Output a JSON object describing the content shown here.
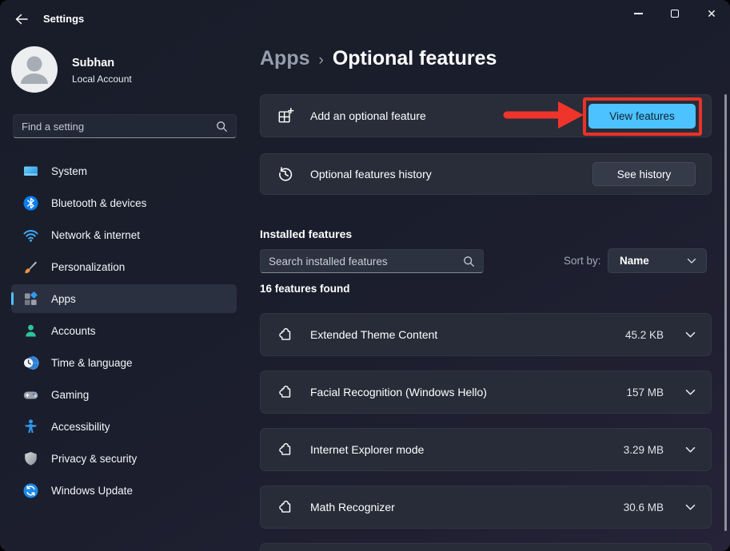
{
  "window": {
    "title": "Settings",
    "controls": {
      "minimize": "minimize",
      "maximize": "maximize",
      "close": "close"
    }
  },
  "user": {
    "name": "Subhan",
    "account_type": "Local Account"
  },
  "sidebar": {
    "search_placeholder": "Find a setting",
    "items": [
      {
        "label": "System",
        "selected": false
      },
      {
        "label": "Bluetooth & devices",
        "selected": false
      },
      {
        "label": "Network & internet",
        "selected": false
      },
      {
        "label": "Personalization",
        "selected": false
      },
      {
        "label": "Apps",
        "selected": true
      },
      {
        "label": "Accounts",
        "selected": false
      },
      {
        "label": "Time & language",
        "selected": false
      },
      {
        "label": "Gaming",
        "selected": false
      },
      {
        "label": "Accessibility",
        "selected": false
      },
      {
        "label": "Privacy & security",
        "selected": false
      },
      {
        "label": "Windows Update",
        "selected": false
      }
    ]
  },
  "breadcrumb": {
    "parent": "Apps",
    "separator": "›",
    "current": "Optional features"
  },
  "actions": {
    "add_feature": {
      "label": "Add an optional feature",
      "button_label": "View features"
    },
    "history": {
      "label": "Optional features history",
      "button_label": "See history"
    }
  },
  "installed": {
    "heading": "Installed features",
    "search_placeholder": "Search installed features",
    "sort_label": "Sort by:",
    "sort_value": "Name",
    "count_text": "16 features found",
    "features": [
      {
        "name": "Extended Theme Content",
        "size": "45.2 KB"
      },
      {
        "name": "Facial Recognition (Windows Hello)",
        "size": "157 MB"
      },
      {
        "name": "Internet Explorer mode",
        "size": "3.29 MB"
      },
      {
        "name": "Math Recognizer",
        "size": "30.6 MB"
      }
    ]
  },
  "colors": {
    "accent": "#4cc2ff",
    "annotation_red": "#e93229",
    "card_bg": "#272c38"
  }
}
